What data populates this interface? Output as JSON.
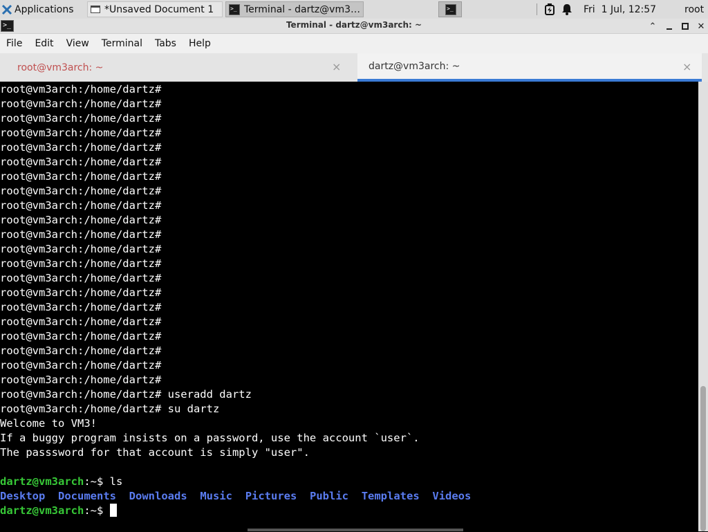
{
  "panel": {
    "applications_label": "Applications",
    "task_editor": "*Unsaved Document 1",
    "task_terminal": "Terminal - dartz@vm3…",
    "clock": "Fri  1 Jul, 12:57",
    "user": "root",
    "icons": [
      "applications-icon",
      "text-editor-icon",
      "terminal-icon",
      "battery-icon",
      "bell-icon"
    ]
  },
  "window": {
    "title": "Terminal - dartz@vm3arch: ~",
    "controls": [
      "minimize",
      "maximize",
      "close"
    ]
  },
  "menu": {
    "file": "File",
    "edit": "Edit",
    "view": "View",
    "terminal": "Terminal",
    "tabs": "Tabs",
    "help": "Help"
  },
  "tabs": {
    "tab1": "root@vm3arch: ~",
    "tab2": "dartz@vm3arch: ~",
    "close_glyph": "×",
    "active_color": "#3a7bd5",
    "inactive_text_color": "#c05050"
  },
  "terminal": {
    "root_prompt": "root@vm3arch:/home/dartz#",
    "cmd1": "root@vm3arch:/home/dartz# useradd dartz",
    "cmd2": "root@vm3arch:/home/dartz# su dartz",
    "msg1": "Welcome to VM3!",
    "msg2": "If a buggy program insists on a password, use the account `user`.",
    "msg3": "The passsword for that account is simply \"user\".",
    "user_prompt": "dartz@vm3arch",
    "user_prompt_suffix": ":~$ ",
    "ls_cmd": "ls",
    "dirs": [
      "Desktop",
      "Documents",
      "Downloads",
      "Music",
      "Pictures",
      "Public",
      "Templates",
      "Videos"
    ],
    "prompt_color": "#37c837",
    "dir_color": "#5a7cf0"
  }
}
